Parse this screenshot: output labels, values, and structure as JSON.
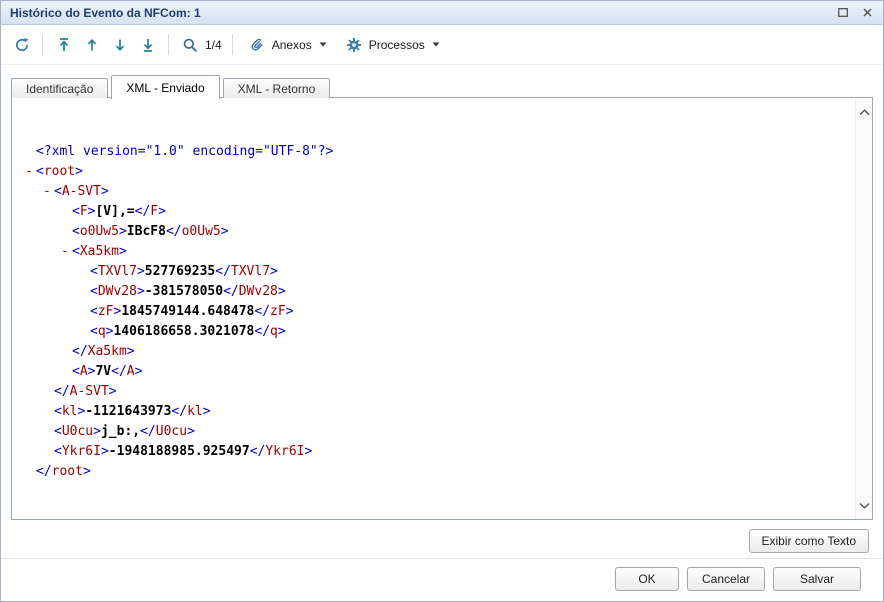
{
  "window": {
    "title": "Histórico do Evento da NFCom: 1"
  },
  "toolbar": {
    "page_indicator": "1/4",
    "anexos": "Anexos",
    "processos": "Processos"
  },
  "tabs": [
    {
      "label": "Identificação",
      "active": false
    },
    {
      "label": "XML - Enviado",
      "active": true
    },
    {
      "label": "XML - Retorno",
      "active": false
    }
  ],
  "xml": {
    "lines": [
      {
        "indent": 0,
        "decl": "<?xml version=\"1.0\" encoding=\"UTF-8\"?>"
      },
      {
        "indent": 0,
        "marker": "-",
        "open": "root"
      },
      {
        "indent": 1,
        "marker": "-",
        "open": "A-SVT"
      },
      {
        "indent": 2,
        "open": "F",
        "value": "[V],=",
        "close": "F"
      },
      {
        "indent": 2,
        "open": "o0Uw5",
        "value": "IBcF8",
        "close": "o0Uw5"
      },
      {
        "indent": 2,
        "marker": "-",
        "open": "Xa5km"
      },
      {
        "indent": 3,
        "open": "TXVl7",
        "value": "527769235",
        "close": "TXVl7"
      },
      {
        "indent": 3,
        "open": "DWv28",
        "value": "-381578050",
        "close": "DWv28"
      },
      {
        "indent": 3,
        "open": "zF",
        "value": "1845749144.648478",
        "close": "zF"
      },
      {
        "indent": 3,
        "open": "q",
        "value": "1406186658.3021078",
        "close": "q"
      },
      {
        "indent": 2,
        "close": "Xa5km"
      },
      {
        "indent": 2,
        "open": "A",
        "value": "7V",
        "close": "A"
      },
      {
        "indent": 1,
        "close": "A-SVT"
      },
      {
        "indent": 1,
        "open": "kl",
        "value": "-1121643973",
        "close": "kl"
      },
      {
        "indent": 1,
        "open": "U0cu",
        "value": "j_b:,",
        "close": "U0cu"
      },
      {
        "indent": 1,
        "open": "Ykr6I",
        "value": "-1948188985.925497",
        "close": "Ykr6I"
      },
      {
        "indent": 0,
        "close": "root"
      }
    ]
  },
  "panel": {
    "exibir_como_texto": "Exibir como Texto"
  },
  "footer": {
    "ok": "OK",
    "cancelar": "Cancelar",
    "salvar": "Salvar"
  },
  "colors": {
    "xml_punct": "#0000cc",
    "xml_tag": "#990000",
    "xml_decl": "#0000cc",
    "marker": "#c00000",
    "toolbar_icon": "#1f7f9f",
    "titlebar_text": "#1d3e70",
    "accent_blue": "#3a6fb0"
  }
}
